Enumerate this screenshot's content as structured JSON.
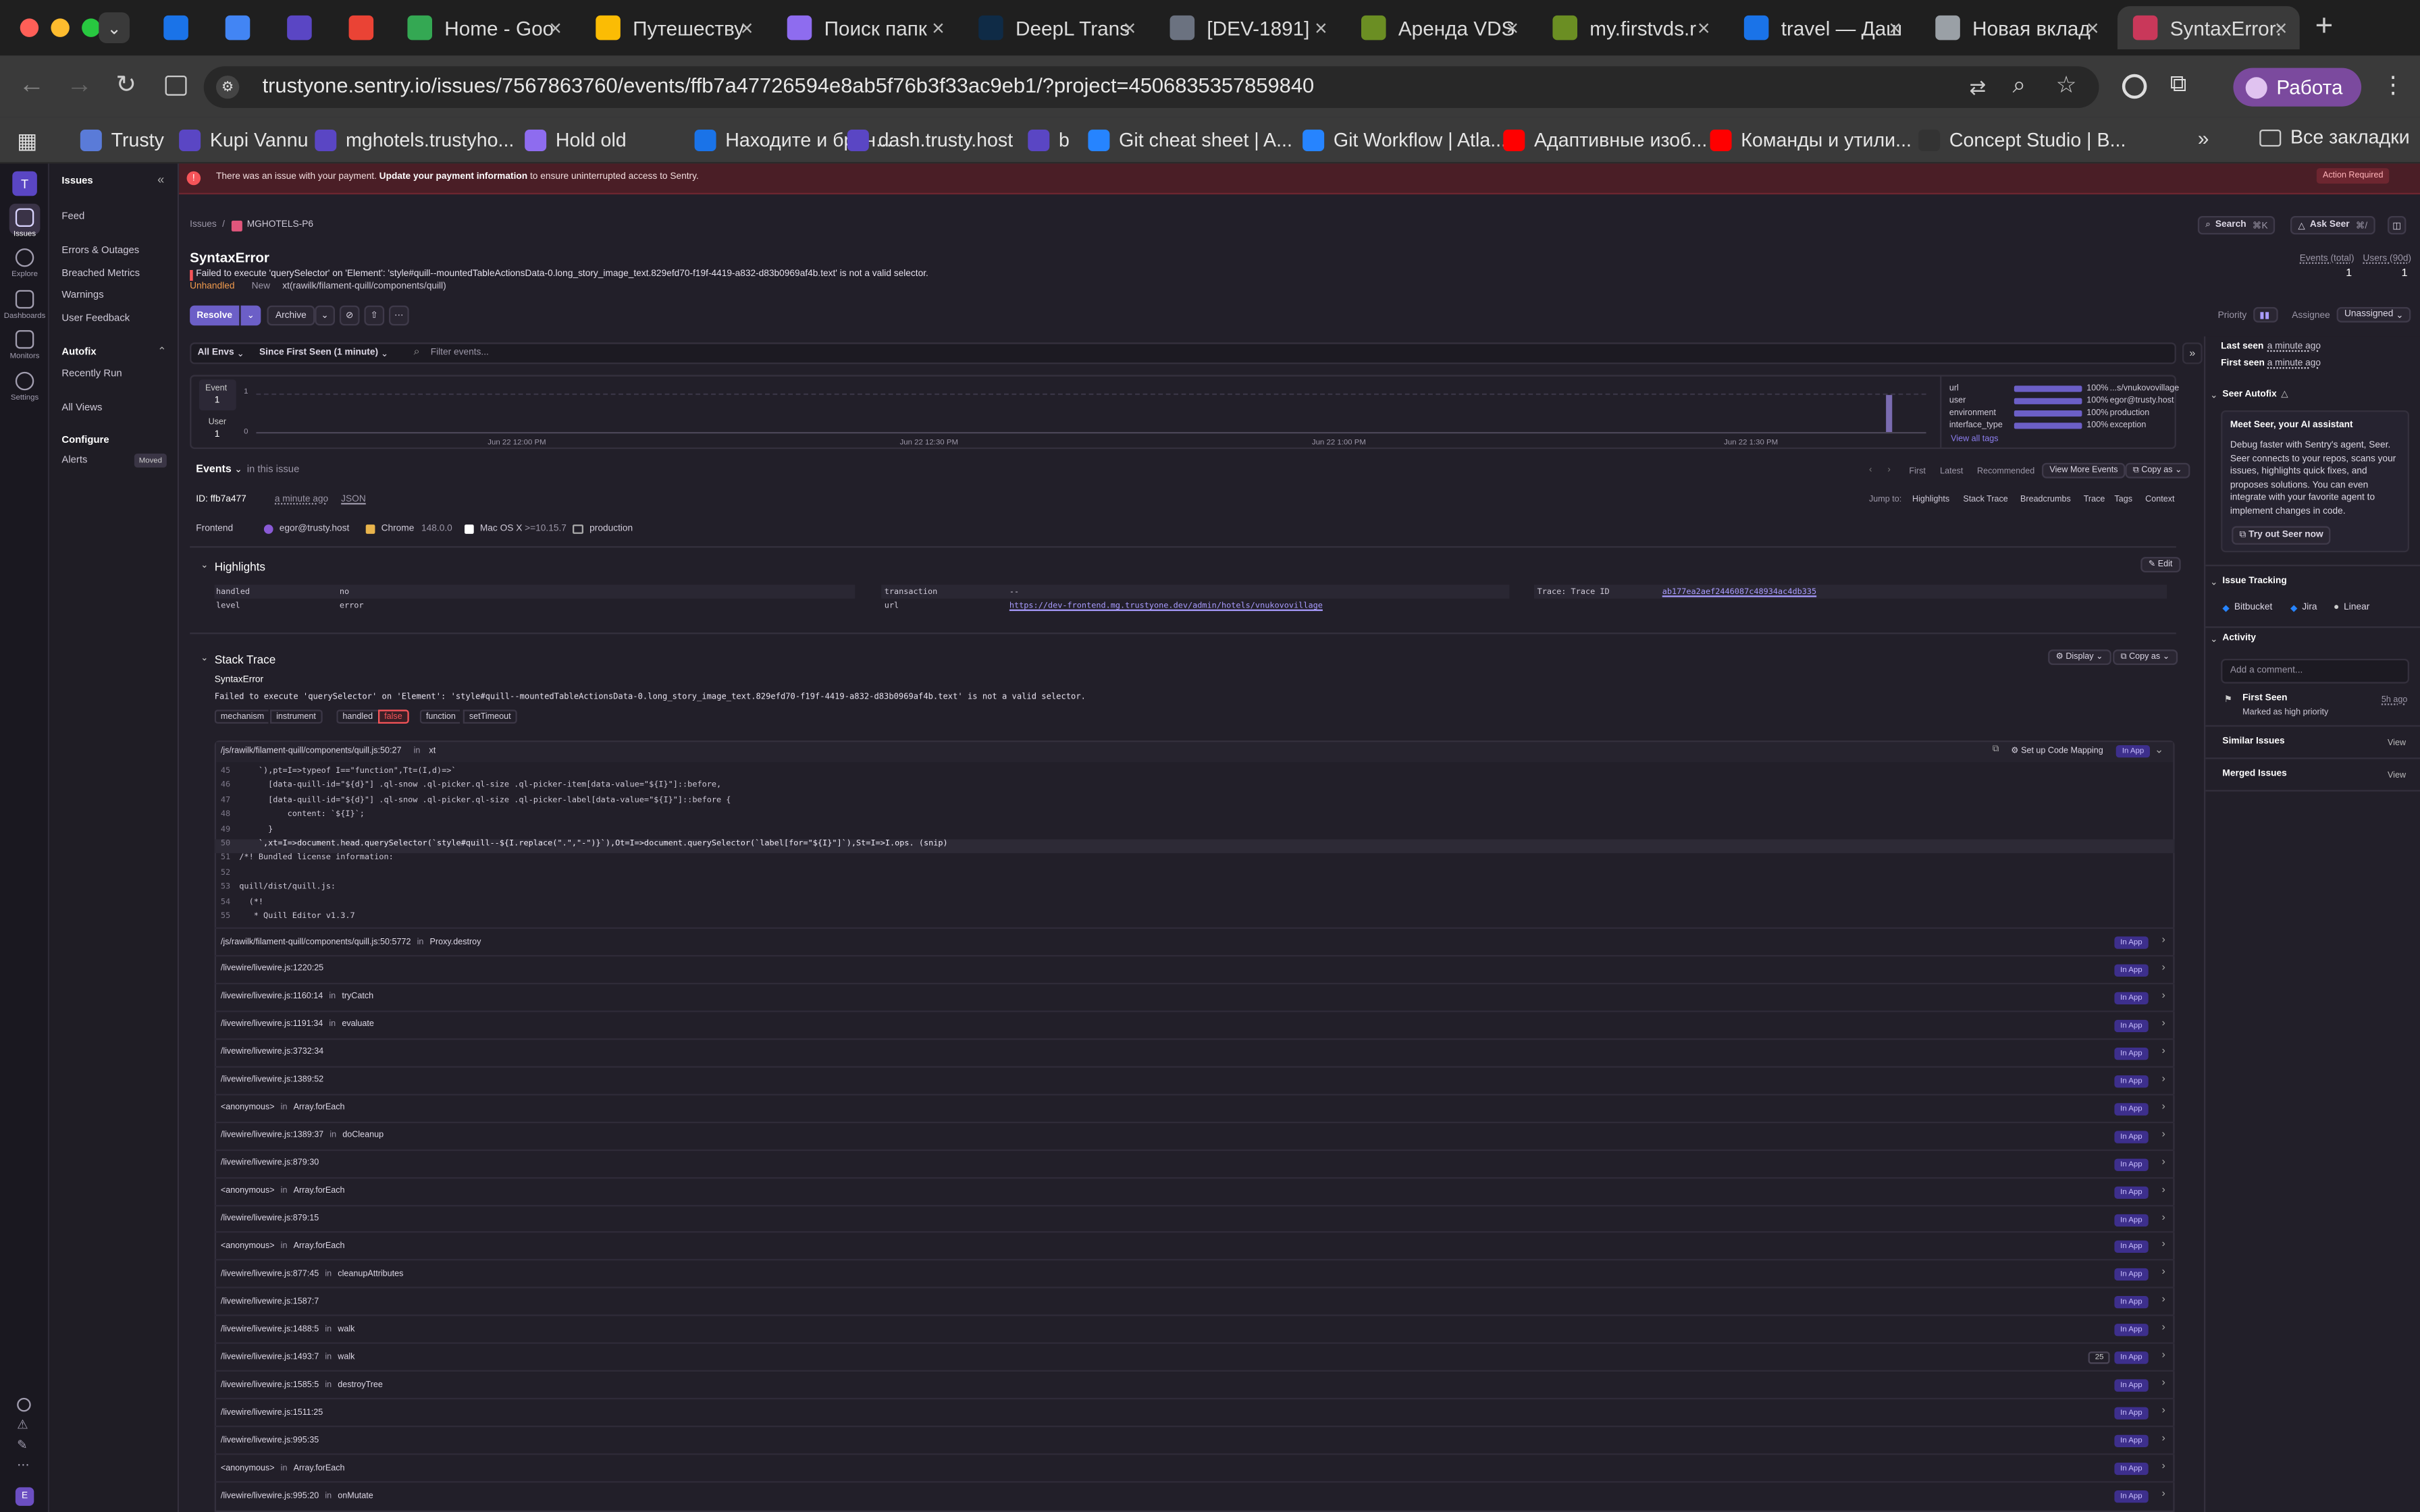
{
  "browser": {
    "tabs": [
      {
        "label": "",
        "fav": "#1a73e8"
      },
      {
        "label": "",
        "fav": "#4285f4"
      },
      {
        "label": "",
        "fav": "#5a46c4"
      },
      {
        "label": "",
        "fav": "#ea4335"
      },
      {
        "label": "Home - Goo",
        "fav": "#34a853"
      },
      {
        "label": "Путешеству",
        "fav": "#fbbc04"
      },
      {
        "label": "Поиск папк",
        "fav": "#8e6cef"
      },
      {
        "label": "DeepL Trans",
        "fav": "#0f2b46"
      },
      {
        "label": "[DEV-1891]",
        "fav": "#6b7280"
      },
      {
        "label": "Аренда VDS",
        "fav": "#6b8e23"
      },
      {
        "label": "my.firstvds.r",
        "fav": "#6b8e23"
      },
      {
        "label": "travel — Даш",
        "fav": "#1a73e8"
      },
      {
        "label": "Новая вклад",
        "fav": "#9aa0a6"
      },
      {
        "label": "SyntaxError:",
        "fav": "#c9385a"
      }
    ],
    "url": "trustyone.sentry.io/issues/7567863760/events/ffb7a47726594e8ab5f76b3f33ac9eb1/?project=4506835357859840",
    "profile": "Работа",
    "bookmarks": [
      {
        "label": "Trusty",
        "color": "#5a7bd8"
      },
      {
        "label": "Kupi Vannu",
        "color": "#5a46c4"
      },
      {
        "label": "mghotels.trustyho...",
        "color": "#5a46c4"
      },
      {
        "label": "Hold old",
        "color": "#8e6cef"
      },
      {
        "label": "Находите и брон...",
        "color": "#1a73e8"
      },
      {
        "label": "dash.trusty.host",
        "color": "#5a46c4"
      },
      {
        "label": "b",
        "color": "#5a46c4"
      },
      {
        "label": "Git cheat sheet | A...",
        "color": "#2684ff"
      },
      {
        "label": "Git Workflow | Atla...",
        "color": "#2684ff"
      },
      {
        "label": "Адаптивные изоб...",
        "color": "#ff0000"
      },
      {
        "label": "Команды и утили...",
        "color": "#ff0000"
      },
      {
        "label": "Concept Studio | B...",
        "color": "#333"
      }
    ],
    "all_bookmarks": "Все закладки"
  },
  "rail": {
    "org": "T",
    "items": [
      "Issues",
      "Explore",
      "Dashboards",
      "Monitors",
      "Settings"
    ],
    "bottom_avatar": "E"
  },
  "sidenav": {
    "title": "Issues",
    "items": [
      "Feed",
      "Errors & Outages",
      "Breached Metrics",
      "Warnings",
      "User Feedback"
    ],
    "autofix_head": "Autofix",
    "autofix_items": [
      "Recently Run"
    ],
    "all_views": "All Views",
    "configure_head": "Configure",
    "configure_items": [
      "Alerts"
    ],
    "moved_badge": "Moved"
  },
  "banner": {
    "text": "There was an issue with your payment.",
    "link": "Update your payment information",
    "suffix": "to ensure uninterrupted access to Sentry.",
    "action": "Action Required"
  },
  "issue": {
    "breadcrumb": [
      "Issues",
      "MGHOTELS-P6"
    ],
    "title": "SyntaxError",
    "message": "Failed to execute 'querySelector' on 'Element': 'style#quill--mountedTableActionsData-0.long_story_image_text.829efd70-f19f-4419-a832-d83b0969af4b.text' is not a valid selector.",
    "status": [
      "Unhandled",
      "New",
      "xt(rawilk/filament-quill/components/quill)"
    ],
    "search": "Search",
    "search_kbd": "⌘K",
    "ask_seer": "Ask Seer",
    "ask_kbd": "⌘/",
    "events_total_label": "Events (total)",
    "events_total": "1",
    "users_label": "Users (90d)",
    "users": "1",
    "resolve": "Resolve",
    "archive": "Archive",
    "priority_label": "Priority",
    "assignee_label": "Assignee",
    "assignee": "Unassigned"
  },
  "filters": {
    "env": "All Envs",
    "since": "Since First Seen (1 minute)",
    "placeholder": "Filter events..."
  },
  "graph": {
    "event_label": "Event",
    "event_value": "1",
    "user_label": "User",
    "user_value": "1",
    "y_top": "1",
    "y_bottom": "0",
    "x_ticks": [
      "Jun 22 12:00 PM",
      "Jun 22 12:30 PM",
      "Jun 22 1:00 PM",
      "Jun 22 1:30 PM"
    ],
    "tags": [
      {
        "key": "url",
        "pct": "100%",
        "val": "...s/vnukovovillage"
      },
      {
        "key": "user",
        "pct": "100%",
        "val": "egor@trusty.host"
      },
      {
        "key": "environment",
        "pct": "100%",
        "val": "production"
      },
      {
        "key": "interface_type",
        "pct": "100%",
        "val": "exception"
      }
    ],
    "view_all": "View all tags"
  },
  "events": {
    "title": "Events",
    "sub": "in this issue",
    "nav": [
      "First",
      "Latest",
      "Recommended"
    ],
    "view_more": "View More Events",
    "copy_as": "Copy as",
    "id": "ID: ffb7a477",
    "ago": "a minute ago",
    "json": "JSON",
    "jump_label": "Jump to:",
    "jump": [
      "Highlights",
      "Stack Trace",
      "Breadcrumbs",
      "Trace",
      "Tags",
      "Context"
    ],
    "platform": "Frontend",
    "user": "egor@trusty.host",
    "browser": "Chrome",
    "browser_ver": "148.0.0",
    "os": "Mac OS X",
    "os_ver": ">=10.15.7",
    "env": "production"
  },
  "highlights": {
    "title": "Highlights",
    "edit": "Edit",
    "left": [
      {
        "k": "handled",
        "v": "no"
      },
      {
        "k": "level",
        "v": "error"
      }
    ],
    "mid": [
      {
        "k": "transaction",
        "v": "--"
      },
      {
        "k": "url",
        "v": "https://dev-frontend.mg.trustyone.dev/admin/hotels/vnukovovillage"
      }
    ],
    "right": [
      {
        "k": "Trace: Trace ID",
        "v": "ab177ea2aef2446087c48934ac4db335"
      }
    ]
  },
  "stack": {
    "title": "Stack Trace",
    "display": "Display",
    "copy_as": "Copy as",
    "exc_type": "SyntaxError",
    "exc_msg": "Failed to execute 'querySelector' on 'Element': 'style#quill--mountedTableActionsData-0.long_story_image_text.829efd70-f19f-4419-a832-d83b0969af4b.text' is not a valid selector.",
    "mech": [
      "mechanism",
      "instrument",
      "handled",
      "false",
      "function",
      "setTimeout"
    ],
    "frame_file": "/js/rawilk/filament-quill/components/quill.js:50:27",
    "frame_in": "in",
    "frame_fn": "xt",
    "code_mapping": "Set up Code Mapping",
    "in_app": "In App",
    "code": [
      {
        "n": "45",
        "t": "    `),pt=I=>typeof I==\"function\",Tt=(I,d)=>`"
      },
      {
        "n": "46",
        "t": "      [data-quill-id=\"${d}\"] .ql-snow .ql-picker.ql-size .ql-picker-item[data-value=\"${I}\"]::before,"
      },
      {
        "n": "47",
        "t": "      [data-quill-id=\"${d}\"] .ql-snow .ql-picker.ql-size .ql-picker-label[data-value=\"${I}\"]::before {"
      },
      {
        "n": "48",
        "t": "          content: `${I}`;"
      },
      {
        "n": "49",
        "t": "      }"
      },
      {
        "n": "50",
        "t": "    `,xt=I=>document.head.querySelector(`style#quill--${I.replace(\".\",\"-\")}`),Ot=I=>document.querySelector(`label[for=\"${I}\"]`),St=I=>I.ops. (snip)"
      },
      {
        "n": "51",
        "t": "/*! Bundled license information:"
      },
      {
        "n": "52",
        "t": ""
      },
      {
        "n": "53",
        "t": "quill/dist/quill.js:"
      },
      {
        "n": "54",
        "t": "  (*!"
      },
      {
        "n": "55",
        "t": "   * Quill Editor v1.3.7"
      }
    ],
    "frames": [
      {
        "file": "/js/rawilk/filament-quill/components/quill.js:50:5772",
        "fn": "Proxy.destroy"
      },
      {
        "file": "/livewire/livewire.js:1220:25",
        "fn": ""
      },
      {
        "file": "/livewire/livewire.js:1160:14",
        "fn": "tryCatch"
      },
      {
        "file": "/livewire/livewire.js:1191:34",
        "fn": "evaluate"
      },
      {
        "file": "/livewire/livewire.js:3732:34",
        "fn": ""
      },
      {
        "file": "/livewire/livewire.js:1389:52",
        "fn": ""
      },
      {
        "file": "<anonymous>",
        "fn": "Array.forEach"
      },
      {
        "file": "/livewire/livewire.js:1389:37",
        "fn": "doCleanup"
      },
      {
        "file": "/livewire/livewire.js:879:30",
        "fn": ""
      },
      {
        "file": "<anonymous>",
        "fn": "Array.forEach"
      },
      {
        "file": "/livewire/livewire.js:879:15",
        "fn": ""
      },
      {
        "file": "<anonymous>",
        "fn": "Array.forEach"
      },
      {
        "file": "/livewire/livewire.js:877:45",
        "fn": "cleanupAttributes"
      },
      {
        "file": "/livewire/livewire.js:1587:7",
        "fn": ""
      },
      {
        "file": "/livewire/livewire.js:1488:5",
        "fn": "walk"
      },
      {
        "file": "/livewire/livewire.js:1493:7",
        "fn": "walk",
        "count": "25"
      },
      {
        "file": "/livewire/livewire.js:1585:5",
        "fn": "destroyTree"
      },
      {
        "file": "/livewire/livewire.js:1511:25",
        "fn": ""
      },
      {
        "file": "/livewire/livewire.js:995:35",
        "fn": ""
      },
      {
        "file": "<anonymous>",
        "fn": "Array.forEach"
      },
      {
        "file": "/livewire/livewire.js:995:20",
        "fn": "onMutate"
      }
    ]
  },
  "sidebar": {
    "last_seen": "Last seen",
    "last_seen_v": "a minute ago",
    "first_seen": "First seen",
    "first_seen_v": "a minute ago",
    "seer_head": "Seer Autofix",
    "seer_title": "Meet Seer, your AI assistant",
    "seer_body": "Debug faster with Sentry's agent, Seer. Seer connects to your repos, scans your issues, highlights quick fixes, and proposes solutions. You can even integrate with your favorite agent to implement changes in code.",
    "seer_btn": "Try out Seer now",
    "tracking_head": "Issue Tracking",
    "tracking": [
      "Bitbucket",
      "Jira",
      "Linear"
    ],
    "activity_head": "Activity",
    "comment_placeholder": "Add a comment...",
    "activity_item": "First Seen",
    "activity_sub": "Marked as high priority",
    "activity_time": "5h ago",
    "similar": "Similar Issues",
    "merged": "Merged Issues",
    "view": "View"
  },
  "colors": {
    "accent": "#6c5fc7",
    "danger": "#f55459",
    "banner_bg": "#4a1e26"
  }
}
